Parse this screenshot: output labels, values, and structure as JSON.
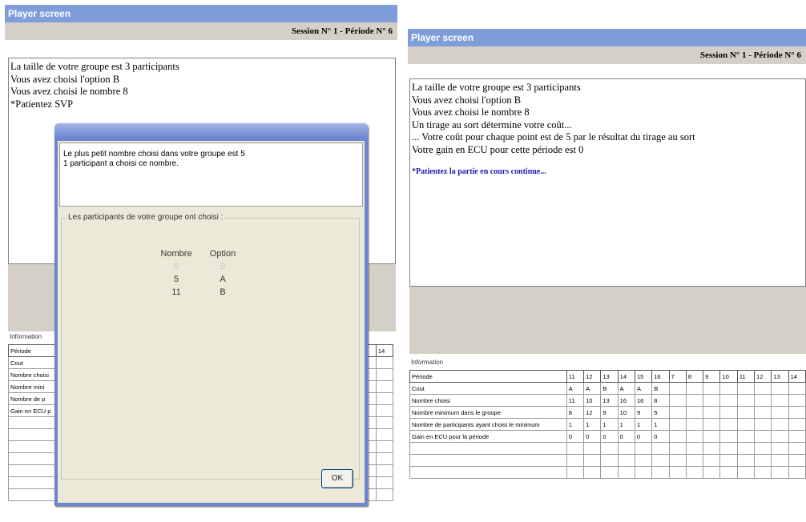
{
  "left_window": {
    "title": "Player screen",
    "session": "Session N° 1  -  Période N° 6",
    "messages": [
      "La taille de votre groupe est 3 participants",
      "Vous avez choisi l'option B",
      "Vous avez choisi le nombre 8",
      "*Patientez SVP"
    ],
    "info_label": "Information",
    "row_labels": [
      "Période",
      "Cout",
      "Nombre choisi",
      "Nombre minimum dans le groupe",
      "Nombre de participants ayant choisi le minimum",
      "Gain en ECU pour la période"
    ],
    "row_labels_visible": [
      "Période",
      "Cout",
      "Nombre choisi",
      "Nombre mini",
      "Nombre de p",
      "Gain en ECU p"
    ],
    "header_tail": [
      "13",
      "14"
    ]
  },
  "dialog": {
    "message_line1": "Le plus petit nombre choisi dans votre groupe est 5",
    "message_line2": "1 participant a choisi ce nombre.",
    "group_label": "Les participants de votre groupe ont choisi :",
    "col_nombre": "Nombre",
    "col_option": "Option",
    "rows": [
      {
        "nombre": "8",
        "option": "B",
        "faded": true
      },
      {
        "nombre": "5",
        "option": "A",
        "faded": false
      },
      {
        "nombre": "11",
        "option": "B",
        "faded": false
      }
    ],
    "ok_label": "OK"
  },
  "right_window": {
    "title": "Player screen",
    "session": "Session N° 1  -  Période N° 6",
    "messages": [
      "La taille de votre groupe est 3 participants",
      "Vous avez choisi l'option B",
      "Vous avez choisi le nombre 8",
      "Un tirage au sort détermine votre coût...",
      "... Votre coût pour chaque point est de 5 par le résultat du tirage au sort",
      "Votre gain en ECU pour cette période est 0"
    ],
    "wait_message": "*Patientez la partie en cours continue...",
    "info_label": "Information",
    "table": {
      "rows": [
        {
          "label": "Période",
          "values": [
            "11",
            "12",
            "13",
            "14",
            "15",
            "16",
            "7",
            "8",
            "9",
            "10",
            "11",
            "12",
            "13",
            "14"
          ]
        },
        {
          "label": "Cout",
          "values": [
            "A",
            "A",
            "B",
            "A",
            "A",
            "B",
            "",
            "",
            "",
            "",
            "",
            "",
            "",
            ""
          ]
        },
        {
          "label": "Nombre choisi",
          "values": [
            "11",
            "10",
            "13",
            "16",
            "16",
            "8",
            "",
            "",
            "",
            "",
            "",
            "",
            "",
            ""
          ]
        },
        {
          "label": "Nombre minimum dans le groupe",
          "values": [
            "8",
            "12",
            "9",
            "10",
            "9",
            "5",
            "",
            "",
            "",
            "",
            "",
            "",
            "",
            ""
          ]
        },
        {
          "label": "Nombre de participants ayant choisi le minimum",
          "values": [
            "1",
            "1",
            "1",
            "1",
            "1",
            "1",
            "",
            "",
            "",
            "",
            "",
            "",
            "",
            ""
          ]
        },
        {
          "label": "Gain en ECU pour la période",
          "values": [
            "0",
            "0",
            "0",
            "0",
            "0",
            "0",
            "",
            "",
            "",
            "",
            "",
            "",
            "",
            ""
          ]
        }
      ]
    }
  }
}
